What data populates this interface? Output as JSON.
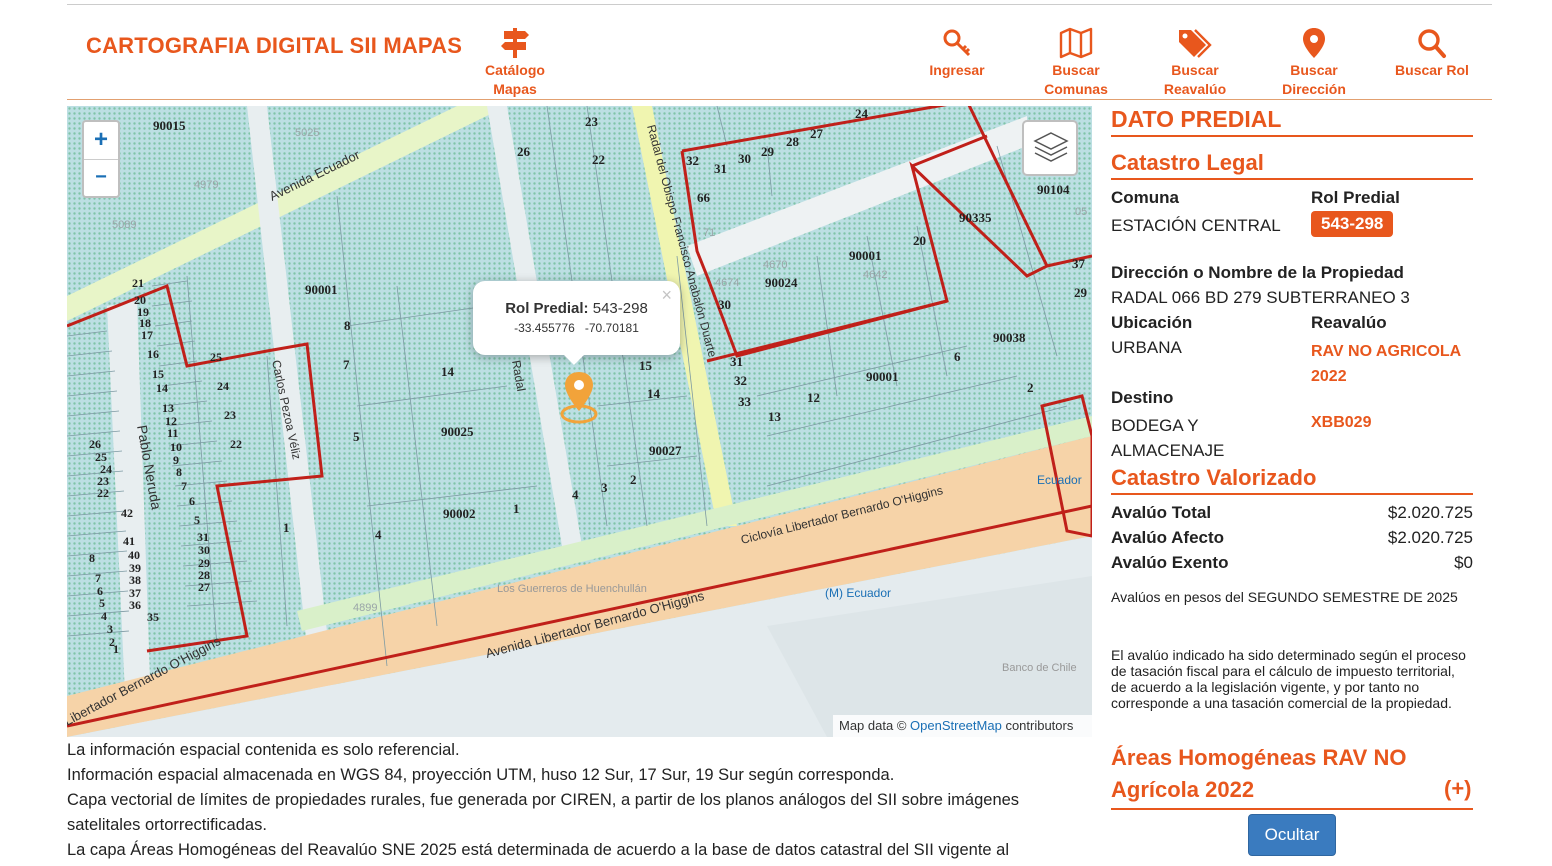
{
  "header": {
    "brand": "CARTOGRAFIA DIGITAL SII MAPAS",
    "nav": [
      {
        "label": "Catálogo Mapas",
        "icon": "signpost-icon"
      },
      {
        "label": "Ingresar",
        "icon": "key-icon"
      },
      {
        "label": "Buscar Comunas",
        "icon": "map-icon"
      },
      {
        "label": "Buscar Reavalúo",
        "icon": "tags-icon"
      },
      {
        "label": "Buscar Dirección",
        "icon": "location-pin-icon"
      },
      {
        "label": "Buscar Rol",
        "icon": "search-icon"
      }
    ]
  },
  "map": {
    "zoom_in": "+",
    "zoom_out": "−",
    "popup": {
      "title_label": "Rol Predial:",
      "title_value": "543-298",
      "lat": "-33.455776",
      "lon": "-70.70181",
      "close": "×"
    },
    "attribution": {
      "prefix": "Map data ©",
      "link": "OpenStreetMap",
      "suffix": "contributors"
    },
    "labels": {
      "streets": [
        "Avenida Ecuador",
        "Pablo Neruda",
        "Carlos Pezoa Véliz",
        "Radal del Obispo Francisco Anabalón Duarte",
        "Ciclovía Libertador Bernardo O'Higgins",
        "Avenida Libertador Bernardo O'Higgins",
        "Libertador Bernardo O'Higgins",
        "Radal",
        "Ecuador"
      ],
      "places": [
        "Los Guerreros de Huenchullán",
        "(M) Ecuador",
        "Banco de Chile"
      ],
      "parcels": [
        "90015",
        "23",
        "26",
        "22",
        "24",
        "27",
        "28",
        "29",
        "30",
        "31",
        "32",
        "66",
        "90104",
        "90335",
        "90001",
        "90024",
        "20",
        "30",
        "37",
        "29",
        "90038",
        "90001",
        "6",
        "14",
        "90025",
        "5",
        "7",
        "8",
        "90001",
        "15",
        "14",
        "90027",
        "13",
        "12",
        "33",
        "32",
        "31",
        "2",
        "4",
        "3",
        "2",
        "90002",
        "1",
        "4",
        "1",
        "21",
        "20",
        "19",
        "18",
        "17",
        "16",
        "15",
        "14",
        "13",
        "12",
        "11",
        "10",
        "9",
        "8",
        "7",
        "6",
        "5",
        "25",
        "24",
        "23",
        "22",
        "31",
        "30",
        "29",
        "28",
        "27",
        "26",
        "25",
        "24",
        "23",
        "22",
        "42",
        "41",
        "40",
        "39",
        "38",
        "37",
        "36",
        "35",
        "8",
        "7",
        "6",
        "5",
        "4",
        "3",
        "2",
        "1"
      ],
      "gray_numbers": [
        "5025",
        "4979",
        "5089",
        "4670",
        "4642",
        "4674",
        "71",
        "4899",
        "05"
      ]
    }
  },
  "notes": [
    "La información espacial contenida es solo referencial.",
    "Información espacial almacenada en WGS 84, proyección UTM, huso 12 Sur, 17 Sur, 19 Sur según corresponda.",
    "Capa vectorial de límites de propiedades rurales, fue generada por CIREN, a partir de los planos análogos del SII sobre imágenes satelitales ortorrectificadas.",
    "La capa Áreas Homogéneas del Reavalúo SNE 2025 está determinada de acuerdo a la base de datos catastral del SII vigente al"
  ],
  "panel": {
    "title": "DATO PREDIAL",
    "legal": {
      "heading": "Catastro Legal",
      "comuna_label": "Comuna",
      "comuna_value": "ESTACIÓN CENTRAL",
      "rol_label": "Rol Predial",
      "rol_value": "543-298",
      "direccion_label": "Dirección o Nombre de la Propiedad",
      "direccion_value": "RADAL 066 BD 279 SUBTERRANEO 3",
      "ubicacion_label": "Ubicación",
      "ubicacion_value": "URBANA",
      "reavaluo_label": "Reavalúo",
      "reavaluo_value": "RAV NO AGRICOLA 2022",
      "destino_label": "Destino",
      "destino_value": "BODEGA Y ALMACENAJE",
      "destino_code": "XBB029"
    },
    "valorizado": {
      "heading": "Catastro Valorizado",
      "rows": [
        {
          "label": "Avalúo Total",
          "value": "$2.020.725"
        },
        {
          "label": "Avalúo Afecto",
          "value": "$2.020.725"
        },
        {
          "label": "Avalúo Exento",
          "value": "$0"
        }
      ],
      "note1": "Avalúos en pesos del SEGUNDO SEMESTRE DE 2025",
      "note2": "El avalúo indicado ha sido determinado según el proceso de tasación fiscal para el cálculo de impuesto territorial, de acuerdo a la legislación vigente, y por tanto no corresponde a una tasación comercial de la propiedad."
    },
    "areas": {
      "heading": "Áreas Homogéneas RAV NO Agrícola 2022",
      "toggle": "(+)"
    },
    "hide_button": "Ocultar"
  },
  "colors": {
    "accent": "#e8571d",
    "parcel_fill": "#a9d4dc",
    "boundary": "#c0201a",
    "button": "#3a7bbf"
  }
}
